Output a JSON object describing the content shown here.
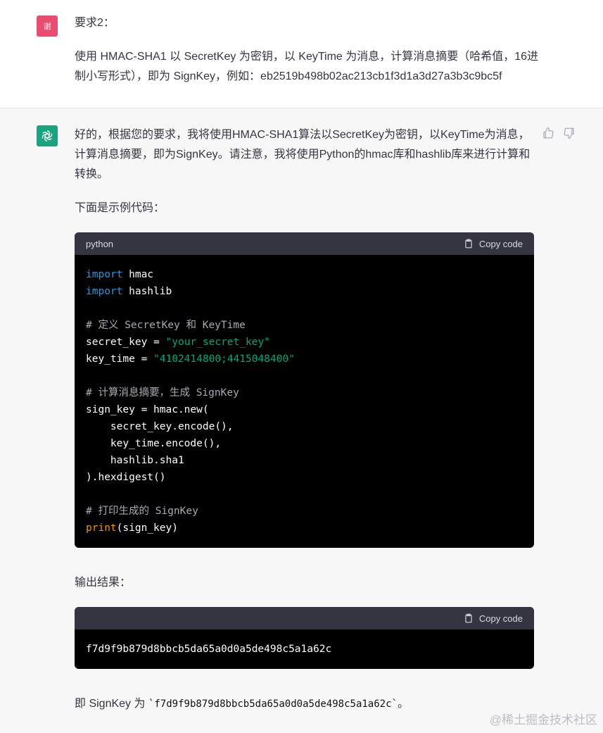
{
  "user": {
    "avatar_text": "谢",
    "avatar_color": "#ea4c6f",
    "line1": "要求2：",
    "line2": "使用 HMAC-SHA1 以 SecretKey 为密钥，以 KeyTime 为消息，计算消息摘要（哈希值，16进制小写形式），即为 SignKey，例如：eb2519b498b02ac213cb1f3d1a3d27a3b3c9bc5f"
  },
  "assistant": {
    "avatar_icon": "openai-logo-icon",
    "avatar_color": "#19a37f",
    "intro": "好的，根据您的要求，我将使用HMAC-SHA1算法以SecretKey为密钥，以KeyTime为消息，计算消息摘要，即为SignKey。请注意，我将使用Python的hmac库和hashlib库来进行计算和转换。",
    "example_heading": "下面是示例代码：",
    "code1": {
      "language": "python",
      "copy_label": "Copy code",
      "lines": {
        "l1_kw": "import",
        "l1_rest": " hmac",
        "l2_kw": "import",
        "l2_rest": " hashlib",
        "l4": "# 定义 SecretKey 和 KeyTime",
        "l5_a": "secret_key = ",
        "l5_s": "\"your_secret_key\"",
        "l6_a": "key_time = ",
        "l6_s": "\"4102414800;4415048400\"",
        "l8": "# 计算消息摘要，生成 SignKey",
        "l9": "sign_key = hmac.new(",
        "l10": "    secret_key.encode(),",
        "l11": "    key_time.encode(),",
        "l12": "    hashlib.sha1",
        "l13": ").hexdigest()",
        "l15": "# 打印生成的 SignKey",
        "l16_fn": "print",
        "l16_rest": "(sign_key)"
      }
    },
    "output_heading": "输出结果：",
    "code2": {
      "copy_label": "Copy code",
      "output": "f7d9f9b879d8bbcb5da65a0d0a5de498c5a1a62c"
    },
    "final_prefix": "即 SignKey 为 ",
    "final_code": "`f7d9f9b879d8bbcb5da65a0d0a5de498c5a1a62c`",
    "final_suffix": "。"
  },
  "watermark": "@稀土掘金技术社区"
}
